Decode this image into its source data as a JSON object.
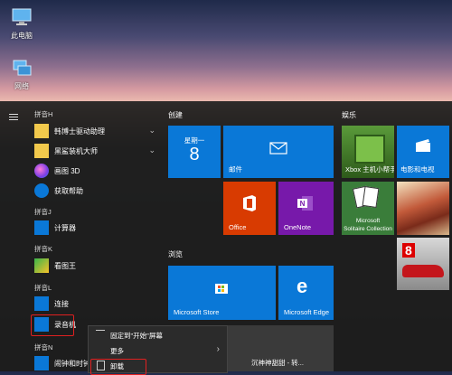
{
  "desktop": {
    "icons": [
      {
        "label": "此电脑",
        "icon": "computer-icon"
      },
      {
        "label": "网络",
        "icon": "network-icon"
      }
    ]
  },
  "applist": {
    "headers": [
      "拼音H",
      "拼音J",
      "拼音K",
      "拼音L",
      "拼音N"
    ],
    "apps": [
      {
        "label": "韩博士驱动助理",
        "icon": "folder-icon",
        "expandable": true
      },
      {
        "label": "黑鲨装机大师",
        "icon": "folder-icon",
        "expandable": true
      },
      {
        "label": "画图 3D",
        "icon": "paint3d-icon"
      },
      {
        "label": "获取帮助",
        "icon": "help-icon"
      },
      {
        "label": "计算器",
        "icon": "calculator-icon"
      },
      {
        "label": "看图王",
        "icon": "image-viewer-icon"
      },
      {
        "label": "连接",
        "icon": "connect-icon"
      },
      {
        "label": "录音机",
        "icon": "recorder-icon"
      },
      {
        "label": "闹钟和时钟",
        "icon": "alarm-clock-icon"
      }
    ]
  },
  "groups": {
    "create": "创建",
    "browse": "浏览",
    "play": "娱乐"
  },
  "tiles": {
    "calendar_day": "星期一",
    "calendar_date": "8",
    "mail": "邮件",
    "office": "Office",
    "onenote": "OneNote",
    "store": "Microsoft Store",
    "edge": "Microsoft Edge",
    "xbox": "Xbox 主机小帮手",
    "movies": "电影和电视",
    "solitaire_line1": "Microsoft",
    "solitaire_line2": "Solitaire Collection",
    "bottom_partial": "沉神神甜甜 - 转..."
  },
  "context_menu": {
    "items": [
      {
        "label": "固定到\"开始\"屏幕",
        "icon": "pin-icon"
      },
      {
        "label": "更多",
        "icon": "more-icon"
      },
      {
        "label": "卸载",
        "icon": "trash-icon"
      }
    ]
  },
  "colors": {
    "tile_blue": "#0a78d7",
    "office_orange": "#d83b01",
    "onenote_purple": "#7719aa",
    "highlight": "#e02020"
  }
}
